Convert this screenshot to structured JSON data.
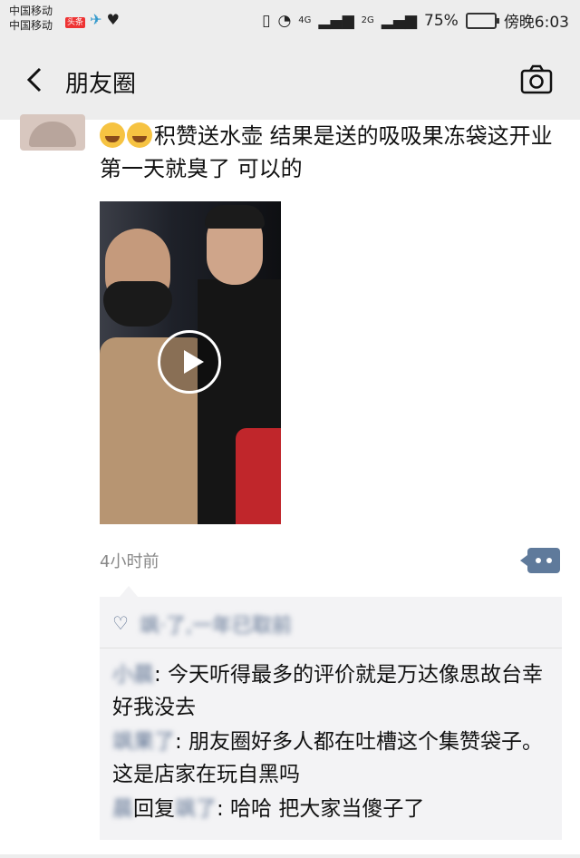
{
  "status": {
    "carrier1": "中国移动",
    "carrier2": "中国移动",
    "signal_badge": "头条",
    "network": "4G",
    "network2": "2G",
    "battery": "75%",
    "time": "傍晚6:03",
    "icons": [
      "vibrate-icon",
      "wifi-icon",
      "signal-icon",
      "battery-icon"
    ]
  },
  "nav": {
    "title": "朋友圈"
  },
  "post": {
    "text": "积赞送水壶  结果是送的吸吸果冻袋这开业第一天就臭了 可以的",
    "time": "4小时前"
  },
  "likes": {
    "text": "飒·了,一年已取前"
  },
  "comments": [
    {
      "name": "小晨",
      "text": ": 今天听得最多的评价就是万达像思故台幸好我没去"
    },
    {
      "name": "飒果了",
      "text": ": 朋友圈好多人都在吐槽这个集赞袋子。这是店家在玩自黑吗"
    },
    {
      "name": "晨",
      "reply_word": "回复",
      "reply_to": "飒了",
      "text": ": 哈哈 把大家当傻子了"
    }
  ]
}
